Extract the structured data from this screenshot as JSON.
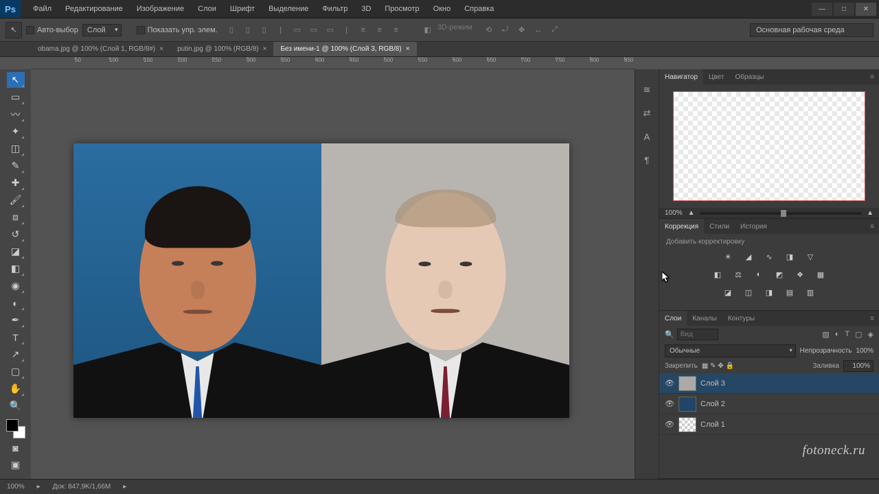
{
  "app": {
    "logo": "Ps"
  },
  "menu": [
    "Файл",
    "Редактирование",
    "Изображение",
    "Слои",
    "Шрифт",
    "Выделение",
    "Фильтр",
    "3D",
    "Просмотр",
    "Окно",
    "Справка"
  ],
  "options": {
    "autoSelect": "Авто-выбор",
    "target": "Слой",
    "showTransform": "Показать упр. элем.",
    "mode3d": "3D-режим",
    "workspace": "Основная рабочая среда"
  },
  "tabs": [
    {
      "label": "obama.jpg @ 100% (Слой 1, RGB/8#)",
      "active": false
    },
    {
      "label": "putin.jpg @ 100% (RGB/8)",
      "active": false
    },
    {
      "label": "Без имени-1 @ 100% (Слой 3, RGB/8)",
      "active": true
    }
  ],
  "rulerMarks": [
    50,
    100,
    150,
    200,
    250,
    300,
    350,
    400,
    450,
    500,
    550,
    600,
    650,
    700,
    750,
    800,
    850
  ],
  "panels": {
    "navigator": {
      "tabs": [
        "Навигатор",
        "Цвет",
        "Образцы"
      ],
      "zoom": "100%"
    },
    "adjustments": {
      "tabs": [
        "Коррекция",
        "Стили",
        "История"
      ],
      "hint": "Добавить корректировку"
    },
    "layers": {
      "tabs": [
        "Слои",
        "Каналы",
        "Контуры"
      ],
      "filterPlaceholder": "Вид",
      "blendMode": "Обычные",
      "opacityLabel": "Непрозрачность",
      "opacity": "100%",
      "lockLabel": "Закрепить",
      "fillLabel": "Заливка",
      "fill": "100%",
      "list": [
        {
          "name": "Слой 3",
          "active": true
        },
        {
          "name": "Слой 2",
          "active": false
        },
        {
          "name": "Слой 1",
          "active": false
        }
      ]
    }
  },
  "status": {
    "zoom": "100%",
    "doc": "Док: 847,9K/1,66M"
  },
  "watermark": "fotoneck.ru"
}
